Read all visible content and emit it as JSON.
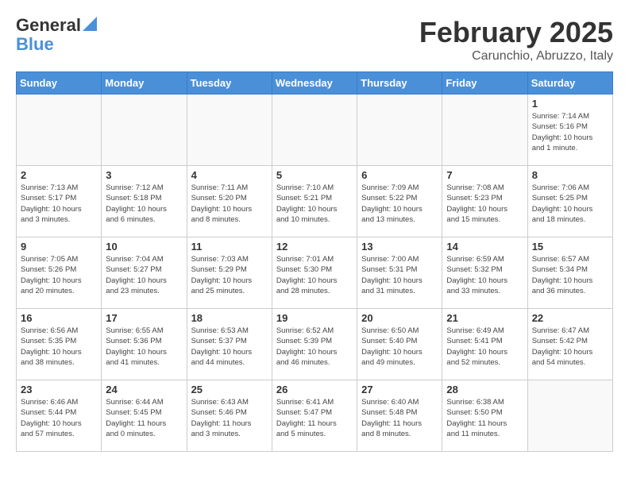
{
  "header": {
    "logo_line1": "General",
    "logo_line2": "Blue",
    "month_title": "February 2025",
    "location": "Carunchio, Abruzzo, Italy"
  },
  "weekdays": [
    "Sunday",
    "Monday",
    "Tuesday",
    "Wednesday",
    "Thursday",
    "Friday",
    "Saturday"
  ],
  "weeks": [
    [
      {
        "day": "",
        "info": ""
      },
      {
        "day": "",
        "info": ""
      },
      {
        "day": "",
        "info": ""
      },
      {
        "day": "",
        "info": ""
      },
      {
        "day": "",
        "info": ""
      },
      {
        "day": "",
        "info": ""
      },
      {
        "day": "1",
        "info": "Sunrise: 7:14 AM\nSunset: 5:16 PM\nDaylight: 10 hours\nand 1 minute."
      }
    ],
    [
      {
        "day": "2",
        "info": "Sunrise: 7:13 AM\nSunset: 5:17 PM\nDaylight: 10 hours\nand 3 minutes."
      },
      {
        "day": "3",
        "info": "Sunrise: 7:12 AM\nSunset: 5:18 PM\nDaylight: 10 hours\nand 6 minutes."
      },
      {
        "day": "4",
        "info": "Sunrise: 7:11 AM\nSunset: 5:20 PM\nDaylight: 10 hours\nand 8 minutes."
      },
      {
        "day": "5",
        "info": "Sunrise: 7:10 AM\nSunset: 5:21 PM\nDaylight: 10 hours\nand 10 minutes."
      },
      {
        "day": "6",
        "info": "Sunrise: 7:09 AM\nSunset: 5:22 PM\nDaylight: 10 hours\nand 13 minutes."
      },
      {
        "day": "7",
        "info": "Sunrise: 7:08 AM\nSunset: 5:23 PM\nDaylight: 10 hours\nand 15 minutes."
      },
      {
        "day": "8",
        "info": "Sunrise: 7:06 AM\nSunset: 5:25 PM\nDaylight: 10 hours\nand 18 minutes."
      }
    ],
    [
      {
        "day": "9",
        "info": "Sunrise: 7:05 AM\nSunset: 5:26 PM\nDaylight: 10 hours\nand 20 minutes."
      },
      {
        "day": "10",
        "info": "Sunrise: 7:04 AM\nSunset: 5:27 PM\nDaylight: 10 hours\nand 23 minutes."
      },
      {
        "day": "11",
        "info": "Sunrise: 7:03 AM\nSunset: 5:29 PM\nDaylight: 10 hours\nand 25 minutes."
      },
      {
        "day": "12",
        "info": "Sunrise: 7:01 AM\nSunset: 5:30 PM\nDaylight: 10 hours\nand 28 minutes."
      },
      {
        "day": "13",
        "info": "Sunrise: 7:00 AM\nSunset: 5:31 PM\nDaylight: 10 hours\nand 31 minutes."
      },
      {
        "day": "14",
        "info": "Sunrise: 6:59 AM\nSunset: 5:32 PM\nDaylight: 10 hours\nand 33 minutes."
      },
      {
        "day": "15",
        "info": "Sunrise: 6:57 AM\nSunset: 5:34 PM\nDaylight: 10 hours\nand 36 minutes."
      }
    ],
    [
      {
        "day": "16",
        "info": "Sunrise: 6:56 AM\nSunset: 5:35 PM\nDaylight: 10 hours\nand 38 minutes."
      },
      {
        "day": "17",
        "info": "Sunrise: 6:55 AM\nSunset: 5:36 PM\nDaylight: 10 hours\nand 41 minutes."
      },
      {
        "day": "18",
        "info": "Sunrise: 6:53 AM\nSunset: 5:37 PM\nDaylight: 10 hours\nand 44 minutes."
      },
      {
        "day": "19",
        "info": "Sunrise: 6:52 AM\nSunset: 5:39 PM\nDaylight: 10 hours\nand 46 minutes."
      },
      {
        "day": "20",
        "info": "Sunrise: 6:50 AM\nSunset: 5:40 PM\nDaylight: 10 hours\nand 49 minutes."
      },
      {
        "day": "21",
        "info": "Sunrise: 6:49 AM\nSunset: 5:41 PM\nDaylight: 10 hours\nand 52 minutes."
      },
      {
        "day": "22",
        "info": "Sunrise: 6:47 AM\nSunset: 5:42 PM\nDaylight: 10 hours\nand 54 minutes."
      }
    ],
    [
      {
        "day": "23",
        "info": "Sunrise: 6:46 AM\nSunset: 5:44 PM\nDaylight: 10 hours\nand 57 minutes."
      },
      {
        "day": "24",
        "info": "Sunrise: 6:44 AM\nSunset: 5:45 PM\nDaylight: 11 hours\nand 0 minutes."
      },
      {
        "day": "25",
        "info": "Sunrise: 6:43 AM\nSunset: 5:46 PM\nDaylight: 11 hours\nand 3 minutes."
      },
      {
        "day": "26",
        "info": "Sunrise: 6:41 AM\nSunset: 5:47 PM\nDaylight: 11 hours\nand 5 minutes."
      },
      {
        "day": "27",
        "info": "Sunrise: 6:40 AM\nSunset: 5:48 PM\nDaylight: 11 hours\nand 8 minutes."
      },
      {
        "day": "28",
        "info": "Sunrise: 6:38 AM\nSunset: 5:50 PM\nDaylight: 11 hours\nand 11 minutes."
      },
      {
        "day": "",
        "info": ""
      }
    ]
  ]
}
